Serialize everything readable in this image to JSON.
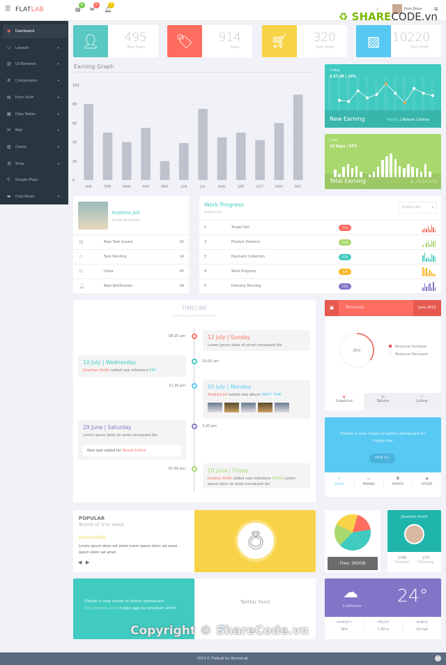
{
  "header": {
    "logo_main": "FLAT",
    "logo_accent": "LAB",
    "menu_icon": "hamburger-icon",
    "notifications": [
      {
        "icon": "tasks-icon",
        "count": "6",
        "color": "#78cd51"
      },
      {
        "icon": "envelope-icon",
        "count": "5",
        "color": "#ff6c60"
      },
      {
        "icon": "bell-icon",
        "count": "7",
        "color": "#f1c500"
      }
    ],
    "search_icon": "search-icon",
    "user_name": "Jhon Doue",
    "watermark": "SHARECODE.vn"
  },
  "sidebar": {
    "items": [
      {
        "label": "Dashboard",
        "icon": "dashboard-icon",
        "active": true,
        "expand": ""
      },
      {
        "label": "Layouts",
        "icon": "laptop-icon",
        "expand": "+"
      },
      {
        "label": "UI Elements",
        "icon": "book-icon",
        "expand": "+"
      },
      {
        "label": "Components",
        "icon": "cogs-icon",
        "expand": "+"
      },
      {
        "label": "Form Stuff",
        "icon": "tasks-icon",
        "expand": "+"
      },
      {
        "label": "Data Tables",
        "icon": "table-icon",
        "expand": "+"
      },
      {
        "label": "Mail",
        "icon": "envelope-icon",
        "expand": "+"
      },
      {
        "label": "Charts",
        "icon": "bar-chart-icon",
        "expand": "+"
      },
      {
        "label": "Shop",
        "icon": "cart-icon",
        "expand": "+"
      },
      {
        "label": "Google Maps",
        "icon": "map-marker-icon",
        "expand": ""
      },
      {
        "label": "Chat Room",
        "icon": "comments-icon",
        "expand": "+"
      }
    ]
  },
  "stats": [
    {
      "value": "495",
      "label": "New Users",
      "icon": "user-icon",
      "color": "#57c8c2"
    },
    {
      "value": "914",
      "label": "Sales",
      "icon": "tags-icon",
      "color": "#ff6c60"
    },
    {
      "value": "320",
      "label": "New Order",
      "icon": "cart-icon",
      "color": "#f8d347"
    },
    {
      "value": "10220",
      "label": "Total Profit",
      "icon": "bar-chart-icon",
      "color": "#57c8f2"
    }
  ],
  "chart_data": {
    "type": "bar",
    "title": "Earning Graph",
    "categories": [
      "JAN",
      "FEB",
      "MAR",
      "APR",
      "MAY",
      "JUN",
      "JUL",
      "AUG",
      "SEP",
      "OCT",
      "NOV",
      "DEC"
    ],
    "values": [
      80,
      50,
      40,
      55,
      20,
      39,
      75,
      45,
      50,
      42,
      60,
      90
    ],
    "ylim": [
      0,
      100
    ],
    "yticks": [
      "0",
      "20",
      "40",
      "60",
      "80",
      "100"
    ],
    "grid": true,
    "color": "#bfc2cd"
  },
  "new_earning": {
    "day": "Friday",
    "amount": "$ 57,00 | 15%",
    "title": "New Earning",
    "links": [
      "Market",
      "Referal",
      "Online"
    ],
    "series": [
      12,
      10,
      28,
      16,
      22,
      40,
      24,
      8,
      32,
      24,
      20
    ]
  },
  "total_earning": {
    "month": "June",
    "stats": "23 Days | 65%",
    "title": "Total Earning",
    "amount": "$, 76,54,678",
    "bars": [
      9,
      4,
      12,
      15,
      10,
      13,
      6,
      0,
      3,
      6,
      12,
      20,
      24,
      27,
      21,
      13,
      10,
      15,
      12,
      10,
      6,
      15,
      6
    ]
  },
  "profile": {
    "name": "Anjelina Joli",
    "role": "Senior Architect",
    "rows": [
      {
        "icon": "tasks-icon",
        "label": "New Task Issued",
        "value": "02"
      },
      {
        "icon": "warning-icon",
        "label": "Task Pending",
        "value": "14"
      },
      {
        "icon": "envelope-icon",
        "label": "Inbox",
        "value": "45"
      },
      {
        "icon": "bell-icon",
        "label": "New Notification",
        "value": "09"
      }
    ]
  },
  "work_progress": {
    "title": "Work Progress",
    "subtitle": "Anjelina Joli",
    "select": "Anjelina Joli",
    "rows": [
      {
        "n": "1",
        "label": "Target Sell",
        "pct": "75%",
        "color": "#ff6c60",
        "spark": [
          3,
          5,
          4,
          8,
          3,
          10,
          6,
          2
        ]
      },
      {
        "n": "2",
        "label": "Product Delivery",
        "pct": "43%",
        "color": "#a9d86e",
        "spark": [
          2,
          0,
          5,
          8,
          3,
          10,
          7,
          9
        ]
      },
      {
        "n": "3",
        "label": "Payment Collection",
        "pct": "67%",
        "color": "#41cac0",
        "spark": [
          8,
          12,
          4,
          6,
          3,
          10,
          8,
          6
        ]
      },
      {
        "n": "4",
        "label": "Work Progress",
        "pct": "30%",
        "color": "#fcb322",
        "spark": [
          12,
          10,
          11,
          4,
          8,
          6,
          3,
          2
        ]
      },
      {
        "n": "5",
        "label": "Delivery Pending",
        "pct": "15%",
        "color": "#8175c7",
        "spark": [
          4,
          10,
          5,
          8,
          10,
          4,
          12,
          4
        ]
      }
    ]
  },
  "timeline": {
    "title": "TIMELINE",
    "subtitle": "This is a project timeline",
    "events": [
      {
        "time": "08:25 am",
        "date": "12 July | Sunday",
        "text": "Lorem ipsum dolor sit amet consiquest dio",
        "color": "#ff6c60"
      },
      {
        "time": "10:00 am",
        "date": "10 July | Wednesday",
        "who": "Jonathan Smith",
        "text": " added new milestone ",
        "tag": "ERP",
        "color": "#41cac0"
      },
      {
        "time": "11:35 am",
        "date": "05 July | Monday",
        "who": "Anjelina Joli",
        "text": " added new album ",
        "tag": "PARTY TIME",
        "color": "#58c9f3"
      },
      {
        "time": "3:20 pm",
        "date": "29 June | Saturday",
        "text": "Lorem ipsum dolor sit amet consiquest dio",
        "note": "New task added for ",
        "note_who": "Denial Collins",
        "color": "#8175c7"
      },
      {
        "time": "07:49 pm",
        "date": "10 June | Friday",
        "who": "Jonatha Smith",
        "text": " added new milestone ",
        "tag": "PRANK",
        "text2": " Lorem ipsum dolor sit amet consiquest dio",
        "color": "#a9d86e"
      }
    ]
  },
  "revenue": {
    "title": "Revenue",
    "period": "June 2013",
    "icon": "picture-icon",
    "percent": "35%",
    "percent_value": 35,
    "legend": [
      "Revenue Increase",
      "Revenue Decrease"
    ],
    "tabs": [
      {
        "label": "Graphical",
        "icon": "circle-icon"
      },
      {
        "label": "Tabular",
        "icon": "grid-icon"
      },
      {
        "label": "Listing",
        "icon": "list-icon"
      }
    ]
  },
  "carousel": {
    "text": "Flatlab is new model of admin dashboard for happy use",
    "button": "VIEW ALL",
    "tabs": [
      {
        "label": "SALES",
        "icon": "list-icon"
      },
      {
        "label": "PROMO",
        "icon": "calendar-icon"
      },
      {
        "label": "PHOTO",
        "icon": "camera-icon"
      },
      {
        "label": "OTHER",
        "icon": "circle-icon"
      }
    ]
  },
  "popular": {
    "title": "POPULAR",
    "subtitle": "Brand of this week",
    "product": "Dimond Ring",
    "text": "Lorem ipsum dolor set amet lorem ipsum dolor set amet ipsum dolor set amet"
  },
  "storage": {
    "label": "Free: 260GB",
    "slices": [
      {
        "value": 40,
        "color": "#41cac0"
      },
      {
        "value": 20,
        "color": "#a9d86e"
      },
      {
        "value": 22,
        "color": "#f8d347"
      },
      {
        "value": 18,
        "color": "#ff6c60"
      }
    ]
  },
  "user_card": {
    "name": "Jonathan Smith",
    "followers": "2789",
    "followers_label": "Follower",
    "following": "270",
    "following_label": "Following"
  },
  "twitter": {
    "quote": "Flatlab is new model of admin dashboard",
    "link": "http://demo.com/",
    "meta": " 4 days ago by jonathan smith",
    "title": "Twitter Feed"
  },
  "weather": {
    "city": "California",
    "temp": "24°",
    "stats": [
      {
        "label": "HUMIDITY",
        "value": "56%"
      },
      {
        "label": "PRECIP",
        "value": "1.50 in"
      },
      {
        "label": "WINDS",
        "value": "10 mph"
      }
    ]
  },
  "footer": {
    "text": "2013 © FlatLab by VectorLab.",
    "watermark": "Copyright © ShareCode.vn"
  }
}
